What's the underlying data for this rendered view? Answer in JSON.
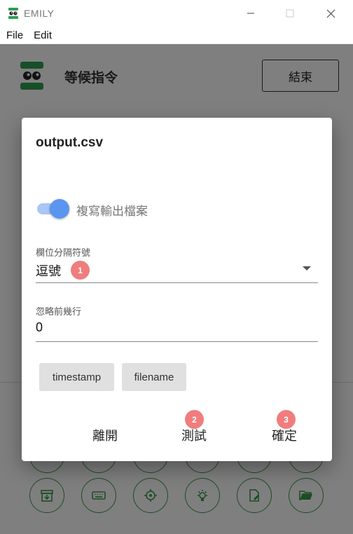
{
  "window": {
    "title": "EMILY",
    "minimize_glyph": "—",
    "maximize_glyph": "☐",
    "close_glyph": "✕"
  },
  "menu": {
    "items": [
      "File",
      "Edit"
    ]
  },
  "header": {
    "status": "等候指令",
    "end_button": "結束"
  },
  "dialog": {
    "title": "output.csv",
    "toggle_label": "複寫輸出檔案",
    "toggle_on": true,
    "delimiter_label": "欄位分隔符號",
    "delimiter_value": "逗號",
    "skip_label": "忽略前幾行",
    "skip_value": "0",
    "chips": [
      "timestamp",
      "filename"
    ],
    "actions": [
      "離開",
      "測試",
      "確定"
    ],
    "badges": [
      "1",
      "2",
      "3"
    ]
  },
  "colors": {
    "brand_green": "#2f9e55",
    "accent_blue": "#5a95f0",
    "badge_red": "#f07d7d"
  },
  "toolbar_icons": [
    "archive-icon",
    "keyboard-icon",
    "crosshair-icon",
    "lightbulb-icon",
    "file-edit-icon",
    "folder-open-icon"
  ]
}
